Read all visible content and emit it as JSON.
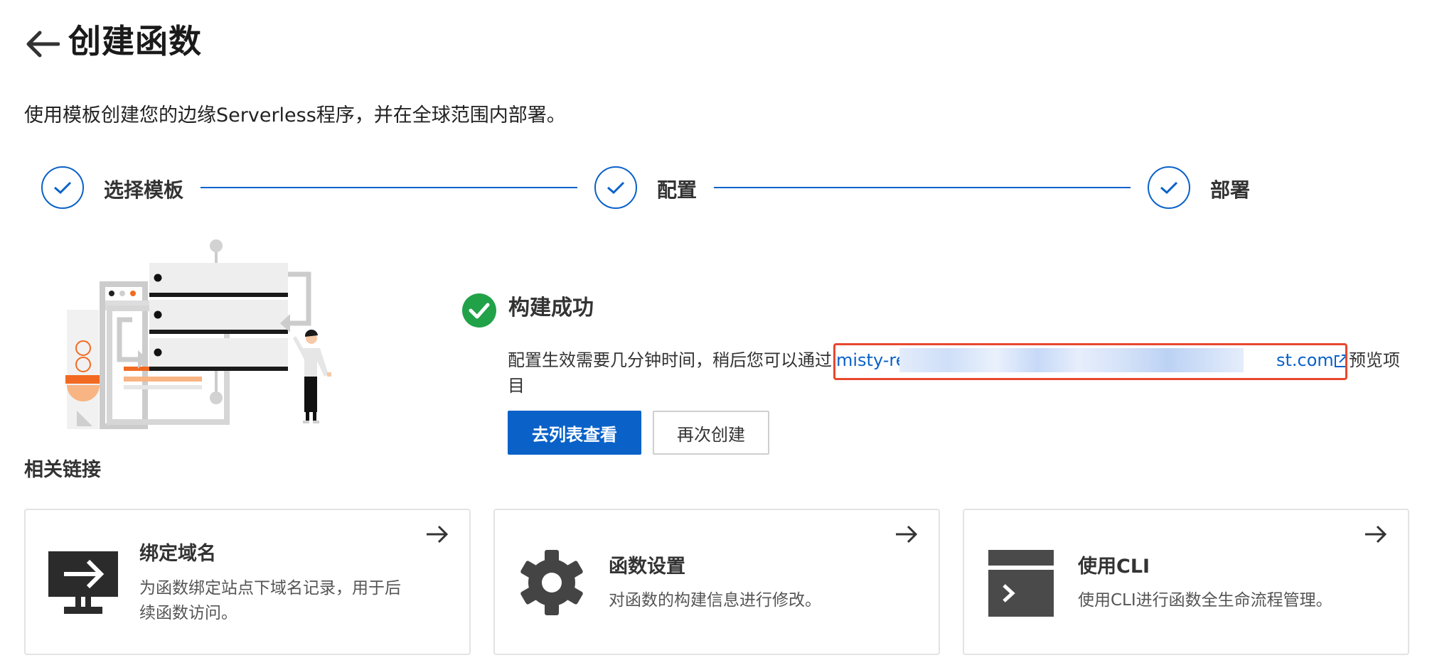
{
  "header": {
    "title": "创建函数",
    "description": "使用模板创建您的边缘Serverless程序，并在全球范围内部署。"
  },
  "steps": [
    {
      "label": "选择模板",
      "status": "completed"
    },
    {
      "label": "配置",
      "status": "completed"
    },
    {
      "label": "部署",
      "status": "completed"
    }
  ],
  "result": {
    "title": "构建成功",
    "message_before_link": "配置生效需要几分钟时间，稍后您可以通过",
    "link_start": "misty-re",
    "link_end": "st.com",
    "message_after_link": "预览项",
    "message_wrap": "目",
    "primary_button": "去列表查看",
    "secondary_button": "再次创建"
  },
  "related": {
    "title": "相关链接",
    "cards": [
      {
        "title": "绑定域名",
        "desc_line1": "为函数绑定站点下域名记录，用于后",
        "desc_line2": "续函数访问。",
        "icon": "monitor-arrow-icon"
      },
      {
        "title": "函数设置",
        "desc_line1": "对函数的构建信息进行修改。",
        "icon": "gear-icon"
      },
      {
        "title": "使用CLI",
        "desc_line1": "使用CLI进行函数全生命流程管理。",
        "icon": "terminal-icon"
      }
    ]
  },
  "colors": {
    "primary": "#0a62c9",
    "success": "#21a249",
    "highlight_border": "#e8472e",
    "accent_orange": "#f26a21"
  }
}
